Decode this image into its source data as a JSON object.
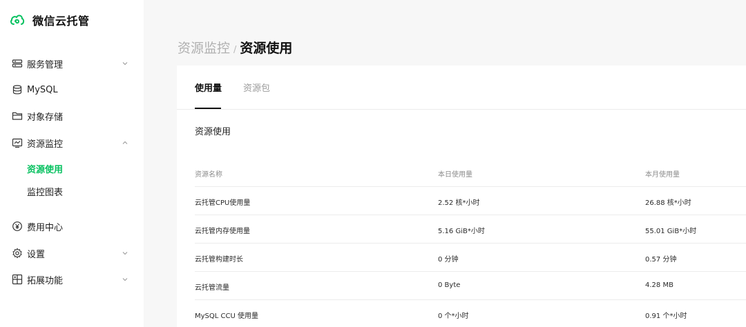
{
  "brand": {
    "name": "微信云托管"
  },
  "sidebar": {
    "items": [
      {
        "label": "服务管理",
        "icon": "server-icon",
        "expandable": true,
        "expanded": false
      },
      {
        "label": "MySQL",
        "icon": "database-icon",
        "expandable": false
      },
      {
        "label": "对象存储",
        "icon": "folder-icon",
        "expandable": false
      },
      {
        "label": "资源监控",
        "icon": "monitor-chart-icon",
        "expandable": true,
        "expanded": true
      },
      {
        "label": "费用中心",
        "icon": "yen-icon",
        "expandable": false
      },
      {
        "label": "设置",
        "icon": "gear-icon",
        "expandable": true,
        "expanded": false
      },
      {
        "label": "拓展功能",
        "icon": "extension-grid-icon",
        "expandable": true,
        "expanded": false
      }
    ],
    "sub_items": [
      {
        "label": "资源使用",
        "active": true
      },
      {
        "label": "监控图表",
        "active": false
      }
    ]
  },
  "breadcrumb": {
    "parent": "资源监控",
    "separator": "/",
    "current": "资源使用"
  },
  "tabs": [
    {
      "label": "使用量",
      "active": true
    },
    {
      "label": "资源包",
      "active": false
    }
  ],
  "section": {
    "title": "资源使用"
  },
  "table": {
    "columns": [
      "资源名称",
      "本日使用量",
      "本月使用量"
    ],
    "rows": [
      [
        "云托管CPU使用量",
        "2.52 核*小时",
        "26.88 核*小时"
      ],
      [
        "云托管内存使用量",
        "5.16 GiB*小时",
        "55.01 GiB*小时"
      ],
      [
        "云托管构建时长",
        "0 分钟",
        "0.57 分钟"
      ],
      [
        "云托管流量",
        "0 Byte",
        "4.28 MB"
      ],
      [
        "MySQL CCU 使用量",
        "0 个*小时",
        "0.91 个*小时"
      ]
    ]
  },
  "colors": {
    "accent": "#07c160",
    "main_bg": "#f7f7f7",
    "card_bg": "#ffffff"
  }
}
